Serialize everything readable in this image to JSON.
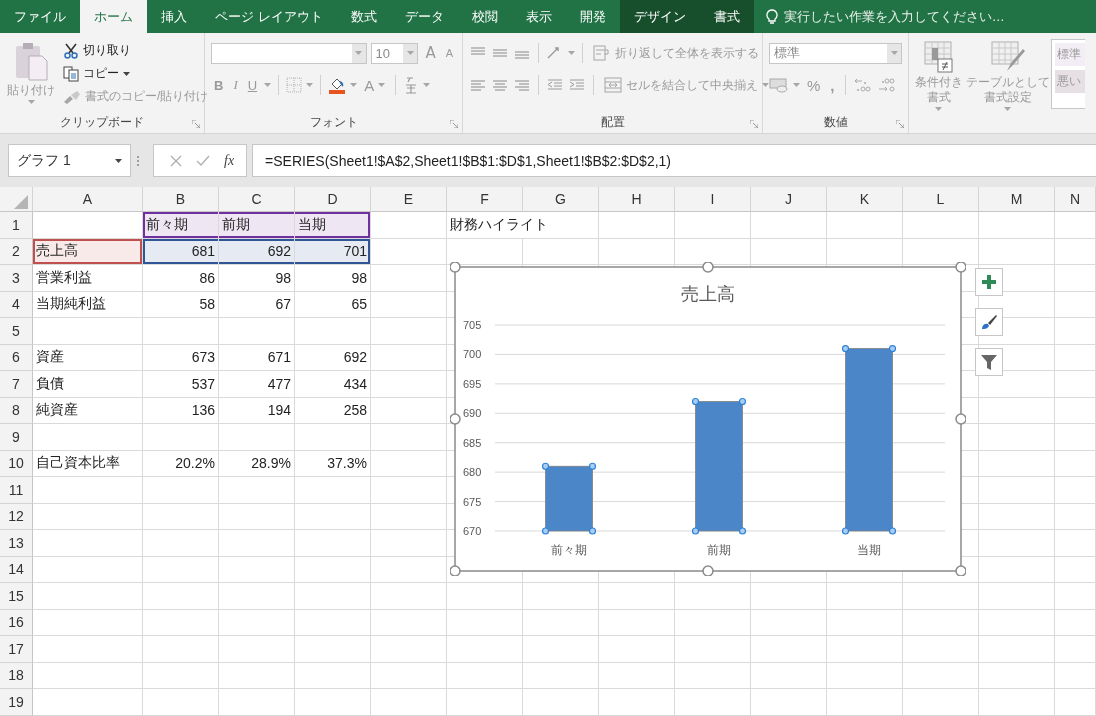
{
  "tabs": [
    {
      "label": "ファイル",
      "kind": "normal",
      "selected": false
    },
    {
      "label": "ホーム",
      "kind": "normal",
      "selected": true
    },
    {
      "label": "挿入",
      "kind": "normal",
      "selected": false
    },
    {
      "label": "ページ レイアウト",
      "kind": "normal",
      "selected": false
    },
    {
      "label": "数式",
      "kind": "normal",
      "selected": false
    },
    {
      "label": "データ",
      "kind": "normal",
      "selected": false
    },
    {
      "label": "校閲",
      "kind": "normal",
      "selected": false
    },
    {
      "label": "表示",
      "kind": "normal",
      "selected": false
    },
    {
      "label": "開発",
      "kind": "normal",
      "selected": false
    },
    {
      "label": "デザイン",
      "kind": "contextual",
      "selected": false
    },
    {
      "label": "書式",
      "kind": "contextual",
      "selected": false
    }
  ],
  "tell_me": {
    "placeholder": "実行したい作業を入力してください…"
  },
  "ribbon": {
    "clipboard": {
      "label": "クリップボード",
      "buttons": [
        {
          "kind": "paste",
          "label": "貼り付け",
          "disabled": true
        },
        {
          "kind": "cut",
          "label": "切り取り",
          "disabled": false
        },
        {
          "kind": "copy",
          "label": "コピー",
          "disabled": false
        },
        {
          "kind": "format_painter",
          "label": "書式のコピー/貼り付け",
          "disabled": true
        }
      ]
    },
    "font": {
      "label": "フォント",
      "font_size": "10",
      "disabled": true,
      "grow": "A",
      "shrink": "A",
      "bold": "B",
      "italic": "I",
      "underline": "U",
      "font_color": "A"
    },
    "alignment": {
      "label": "配置",
      "disabled": true,
      "wrap": "折り返して全体を表示する",
      "merge": "セルを結合して中央揃え"
    },
    "number": {
      "label": "数値",
      "disabled": true,
      "format": "標準",
      "percent": "%",
      "comma": ","
    },
    "styles": {
      "disabled": true,
      "conditional": "条件付き書式",
      "table": "テーブルとして書式設定",
      "gallery": [
        "標準",
        "悪い"
      ]
    }
  },
  "formula_bar": {
    "name_box": "グラフ 1",
    "function_button": "fx",
    "formula": "=SERIES(Sheet1!$A$2,Sheet1!$B$1:$D$1,Sheet1!$B$2:$D$2,1)"
  },
  "grid": {
    "columns": [
      "A",
      "B",
      "C",
      "D",
      "E",
      "F",
      "G",
      "H",
      "I",
      "J",
      "K",
      "L",
      "M",
      "N"
    ],
    "rows": [
      {
        "number": "1",
        "cells": [
          {},
          {
            "value": "前々期",
            "kind": "text",
            "color": "#7030a0"
          },
          {
            "value": "前期",
            "kind": "text",
            "color": "#7030a0"
          },
          {
            "value": "当期",
            "kind": "text",
            "color": "#7030a0"
          },
          {},
          {
            "value": "財務ハイライト",
            "kind": "text"
          }
        ]
      },
      {
        "number": "2",
        "cells": [
          {
            "value": "売上高",
            "kind": "text",
            "color": "#c0504d"
          },
          {
            "value": "681",
            "kind": "number",
            "color": "#2f5597"
          },
          {
            "value": "692",
            "kind": "number",
            "color": "#2f5597"
          },
          {
            "value": "701",
            "kind": "number",
            "color": "#2f5597"
          }
        ]
      },
      {
        "number": "3",
        "cells": [
          {
            "value": "営業利益",
            "kind": "text"
          },
          {
            "value": "86",
            "kind": "number"
          },
          {
            "value": "98",
            "kind": "number"
          },
          {
            "value": "98",
            "kind": "number"
          }
        ]
      },
      {
        "number": "4",
        "cells": [
          {
            "value": "当期純利益",
            "kind": "text"
          },
          {
            "value": "58",
            "kind": "number"
          },
          {
            "value": "67",
            "kind": "number"
          },
          {
            "value": "65",
            "kind": "number"
          }
        ]
      },
      {
        "number": "5",
        "cells": []
      },
      {
        "number": "6",
        "cells": [
          {
            "value": "資産",
            "kind": "text"
          },
          {
            "value": "673",
            "kind": "number"
          },
          {
            "value": "671",
            "kind": "number"
          },
          {
            "value": "692",
            "kind": "number"
          }
        ]
      },
      {
        "number": "7",
        "cells": [
          {
            "value": "負債",
            "kind": "text"
          },
          {
            "value": "537",
            "kind": "number"
          },
          {
            "value": "477",
            "kind": "number"
          },
          {
            "value": "434",
            "kind": "number"
          }
        ]
      },
      {
        "number": "8",
        "cells": [
          {
            "value": "純資産",
            "kind": "text"
          },
          {
            "value": "136",
            "kind": "number"
          },
          {
            "value": "194",
            "kind": "number"
          },
          {
            "value": "258",
            "kind": "number"
          }
        ]
      },
      {
        "number": "9",
        "cells": []
      },
      {
        "number": "10",
        "cells": [
          {
            "value": "自己資本比率",
            "kind": "text"
          },
          {
            "value": "20.2%",
            "kind": "number"
          },
          {
            "value": "28.9%",
            "kind": "number"
          },
          {
            "value": "37.3%",
            "kind": "number"
          }
        ]
      },
      {
        "number": "11",
        "cells": []
      },
      {
        "number": "12",
        "cells": []
      },
      {
        "number": "13",
        "cells": []
      },
      {
        "number": "14",
        "cells": []
      },
      {
        "number": "15",
        "cells": []
      },
      {
        "number": "16",
        "cells": []
      },
      {
        "number": "17",
        "cells": []
      },
      {
        "number": "18",
        "cells": []
      },
      {
        "number": "19",
        "cells": []
      }
    ]
  },
  "chart": {
    "selected": true,
    "chart_data": {
      "type": "bar",
      "title": "売上高",
      "categories": [
        "前々期",
        "前期",
        "当期"
      ],
      "series": [
        {
          "color": "#4a86c8",
          "values": [
            681,
            692,
            701
          ]
        }
      ],
      "ylim": [
        670,
        705
      ],
      "grid": true,
      "yticks": [
        670,
        675,
        680,
        685,
        690,
        695,
        700,
        705
      ]
    }
  }
}
